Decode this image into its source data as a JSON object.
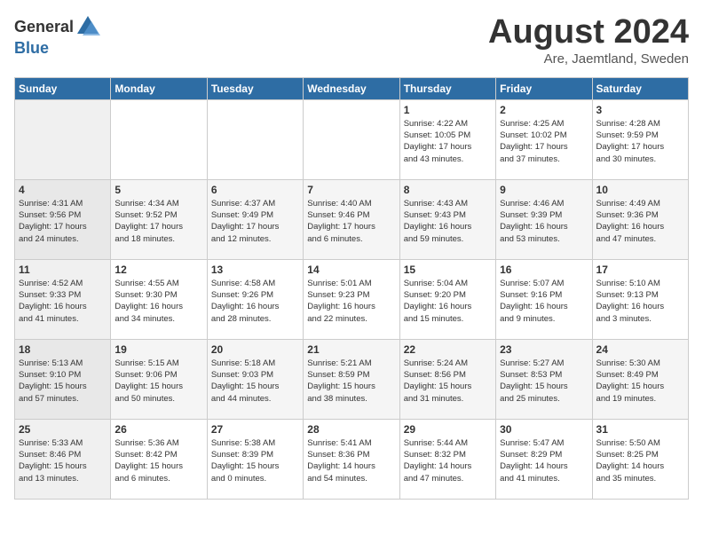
{
  "header": {
    "logo_general": "General",
    "logo_blue": "Blue",
    "title": "August 2024",
    "subtitle": "Are, Jaemtland, Sweden"
  },
  "days_of_week": [
    "Sunday",
    "Monday",
    "Tuesday",
    "Wednesday",
    "Thursday",
    "Friday",
    "Saturday"
  ],
  "weeks": [
    [
      {
        "day": "",
        "info": ""
      },
      {
        "day": "",
        "info": ""
      },
      {
        "day": "",
        "info": ""
      },
      {
        "day": "",
        "info": ""
      },
      {
        "day": "1",
        "info": "Sunrise: 4:22 AM\nSunset: 10:05 PM\nDaylight: 17 hours\nand 43 minutes."
      },
      {
        "day": "2",
        "info": "Sunrise: 4:25 AM\nSunset: 10:02 PM\nDaylight: 17 hours\nand 37 minutes."
      },
      {
        "day": "3",
        "info": "Sunrise: 4:28 AM\nSunset: 9:59 PM\nDaylight: 17 hours\nand 30 minutes."
      }
    ],
    [
      {
        "day": "4",
        "info": "Sunrise: 4:31 AM\nSunset: 9:56 PM\nDaylight: 17 hours\nand 24 minutes."
      },
      {
        "day": "5",
        "info": "Sunrise: 4:34 AM\nSunset: 9:52 PM\nDaylight: 17 hours\nand 18 minutes."
      },
      {
        "day": "6",
        "info": "Sunrise: 4:37 AM\nSunset: 9:49 PM\nDaylight: 17 hours\nand 12 minutes."
      },
      {
        "day": "7",
        "info": "Sunrise: 4:40 AM\nSunset: 9:46 PM\nDaylight: 17 hours\nand 6 minutes."
      },
      {
        "day": "8",
        "info": "Sunrise: 4:43 AM\nSunset: 9:43 PM\nDaylight: 16 hours\nand 59 minutes."
      },
      {
        "day": "9",
        "info": "Sunrise: 4:46 AM\nSunset: 9:39 PM\nDaylight: 16 hours\nand 53 minutes."
      },
      {
        "day": "10",
        "info": "Sunrise: 4:49 AM\nSunset: 9:36 PM\nDaylight: 16 hours\nand 47 minutes."
      }
    ],
    [
      {
        "day": "11",
        "info": "Sunrise: 4:52 AM\nSunset: 9:33 PM\nDaylight: 16 hours\nand 41 minutes."
      },
      {
        "day": "12",
        "info": "Sunrise: 4:55 AM\nSunset: 9:30 PM\nDaylight: 16 hours\nand 34 minutes."
      },
      {
        "day": "13",
        "info": "Sunrise: 4:58 AM\nSunset: 9:26 PM\nDaylight: 16 hours\nand 28 minutes."
      },
      {
        "day": "14",
        "info": "Sunrise: 5:01 AM\nSunset: 9:23 PM\nDaylight: 16 hours\nand 22 minutes."
      },
      {
        "day": "15",
        "info": "Sunrise: 5:04 AM\nSunset: 9:20 PM\nDaylight: 16 hours\nand 15 minutes."
      },
      {
        "day": "16",
        "info": "Sunrise: 5:07 AM\nSunset: 9:16 PM\nDaylight: 16 hours\nand 9 minutes."
      },
      {
        "day": "17",
        "info": "Sunrise: 5:10 AM\nSunset: 9:13 PM\nDaylight: 16 hours\nand 3 minutes."
      }
    ],
    [
      {
        "day": "18",
        "info": "Sunrise: 5:13 AM\nSunset: 9:10 PM\nDaylight: 15 hours\nand 57 minutes."
      },
      {
        "day": "19",
        "info": "Sunrise: 5:15 AM\nSunset: 9:06 PM\nDaylight: 15 hours\nand 50 minutes."
      },
      {
        "day": "20",
        "info": "Sunrise: 5:18 AM\nSunset: 9:03 PM\nDaylight: 15 hours\nand 44 minutes."
      },
      {
        "day": "21",
        "info": "Sunrise: 5:21 AM\nSunset: 8:59 PM\nDaylight: 15 hours\nand 38 minutes."
      },
      {
        "day": "22",
        "info": "Sunrise: 5:24 AM\nSunset: 8:56 PM\nDaylight: 15 hours\nand 31 minutes."
      },
      {
        "day": "23",
        "info": "Sunrise: 5:27 AM\nSunset: 8:53 PM\nDaylight: 15 hours\nand 25 minutes."
      },
      {
        "day": "24",
        "info": "Sunrise: 5:30 AM\nSunset: 8:49 PM\nDaylight: 15 hours\nand 19 minutes."
      }
    ],
    [
      {
        "day": "25",
        "info": "Sunrise: 5:33 AM\nSunset: 8:46 PM\nDaylight: 15 hours\nand 13 minutes."
      },
      {
        "day": "26",
        "info": "Sunrise: 5:36 AM\nSunset: 8:42 PM\nDaylight: 15 hours\nand 6 minutes."
      },
      {
        "day": "27",
        "info": "Sunrise: 5:38 AM\nSunset: 8:39 PM\nDaylight: 15 hours\nand 0 minutes."
      },
      {
        "day": "28",
        "info": "Sunrise: 5:41 AM\nSunset: 8:36 PM\nDaylight: 14 hours\nand 54 minutes."
      },
      {
        "day": "29",
        "info": "Sunrise: 5:44 AM\nSunset: 8:32 PM\nDaylight: 14 hours\nand 47 minutes."
      },
      {
        "day": "30",
        "info": "Sunrise: 5:47 AM\nSunset: 8:29 PM\nDaylight: 14 hours\nand 41 minutes."
      },
      {
        "day": "31",
        "info": "Sunrise: 5:50 AM\nSunset: 8:25 PM\nDaylight: 14 hours\nand 35 minutes."
      }
    ]
  ]
}
